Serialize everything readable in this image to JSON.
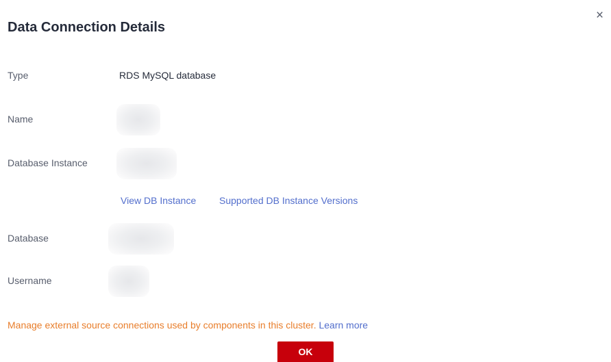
{
  "dialog": {
    "title": "Data Connection Details",
    "close_glyph": "×",
    "close_icon": "close-icon"
  },
  "fields": {
    "type": {
      "label": "Type",
      "value": "RDS MySQL database"
    },
    "name": {
      "label": "Name",
      "value": ""
    },
    "database_instance": {
      "label": "Database Instance",
      "value": ""
    },
    "database": {
      "label": "Database",
      "value": ""
    },
    "username": {
      "label": "Username",
      "value": ""
    }
  },
  "links": {
    "view_db_instance": "View DB Instance",
    "supported_versions": "Supported DB Instance Versions"
  },
  "notice": {
    "text": "Manage external source connections used by components in this cluster.",
    "learn_more": "Learn more"
  },
  "footer": {
    "ok_label": "OK"
  },
  "colors": {
    "primary_button": "#c7000b",
    "link": "#526ecc",
    "notice": "#e87d2a"
  }
}
